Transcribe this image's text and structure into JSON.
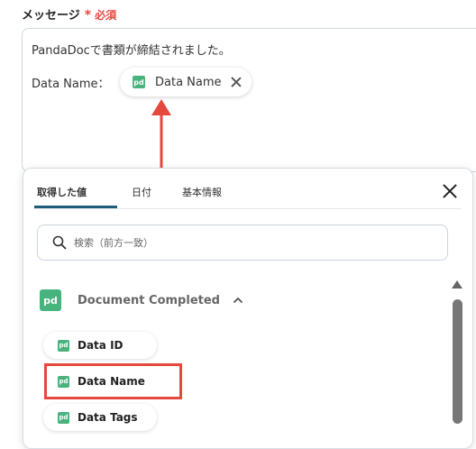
{
  "field": {
    "label": "メッセージ",
    "required_mark": "*",
    "required_text": "必須"
  },
  "message": {
    "line1": "PandaDocで書類が締結されました。",
    "line2_label": "Data Name："
  },
  "variable_chip": {
    "icon": "pandadoc-icon",
    "label": "Data Name",
    "close_icon": "close-icon"
  },
  "panel": {
    "tabs": [
      "取得した値",
      "日付",
      "基本情報"
    ],
    "active_tab": "取得した値",
    "search_placeholder": "検索（前方一致）",
    "section": {
      "title": "Document Completed",
      "icon": "pandadoc-icon",
      "expanded": true
    },
    "items": [
      {
        "label": "Data ID"
      },
      {
        "label": "Data Name"
      },
      {
        "label": "Data Tags"
      }
    ],
    "highlighted_item": "Data Name"
  },
  "colors": {
    "accent_red": "#e5483d",
    "pandadoc_green": "#47b37d",
    "tab_underline": "#1f5c7a"
  }
}
